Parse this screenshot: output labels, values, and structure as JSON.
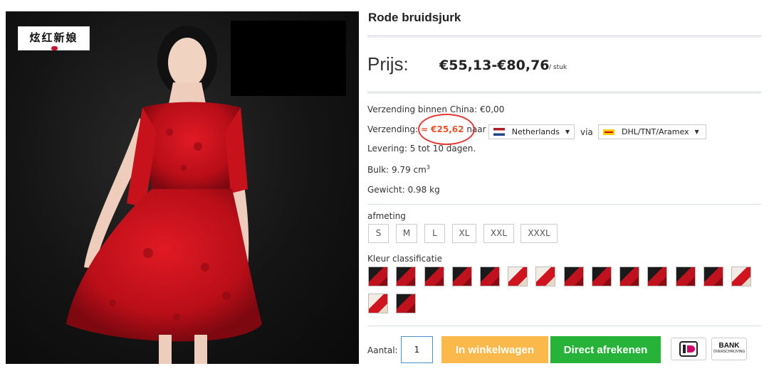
{
  "product": {
    "title": "Rode bruidsjurk",
    "brand_logo_text": "炫红新娘",
    "price_label": "Prijs:",
    "price_range": "€55,13-€80,76",
    "price_unit": "/ stuk"
  },
  "shipping": {
    "domestic": "Verzending binnen China: €0,00",
    "label": "Verzending:",
    "fee": "≈ €25,62",
    "to": "naar",
    "country": "Netherlands",
    "via": "via",
    "carrier": "DHL/TNT/Aramex",
    "delivery": "Levering: 5 tot 10 dagen.",
    "bulk": "Bulk: 9.79 cm",
    "bulk_exp": "3",
    "weight": "Gewicht: 0.98 kg"
  },
  "options": {
    "size_label": "afmeting",
    "sizes": [
      "S",
      "M",
      "L",
      "XL",
      "XXL",
      "XXXL"
    ],
    "color_label": "Kleur classificatie"
  },
  "purchase": {
    "qty_label": "Aantal:",
    "qty_value": "1",
    "cart_button": "In winkelwagen",
    "buy_button": "Direct afrekenen",
    "pay_bank_text": "BANK",
    "pay_bank_sub": "OVERSCHRIJVING"
  },
  "colors": {
    "cart": "#fbb84b",
    "buy": "#27b339",
    "fee": "#e8532b",
    "circle": "#e53935"
  },
  "icons": [
    "nl-flag-icon",
    "dhl-icon",
    "chevron-down-icon",
    "ideal-icon",
    "bank-transfer-icon"
  ]
}
